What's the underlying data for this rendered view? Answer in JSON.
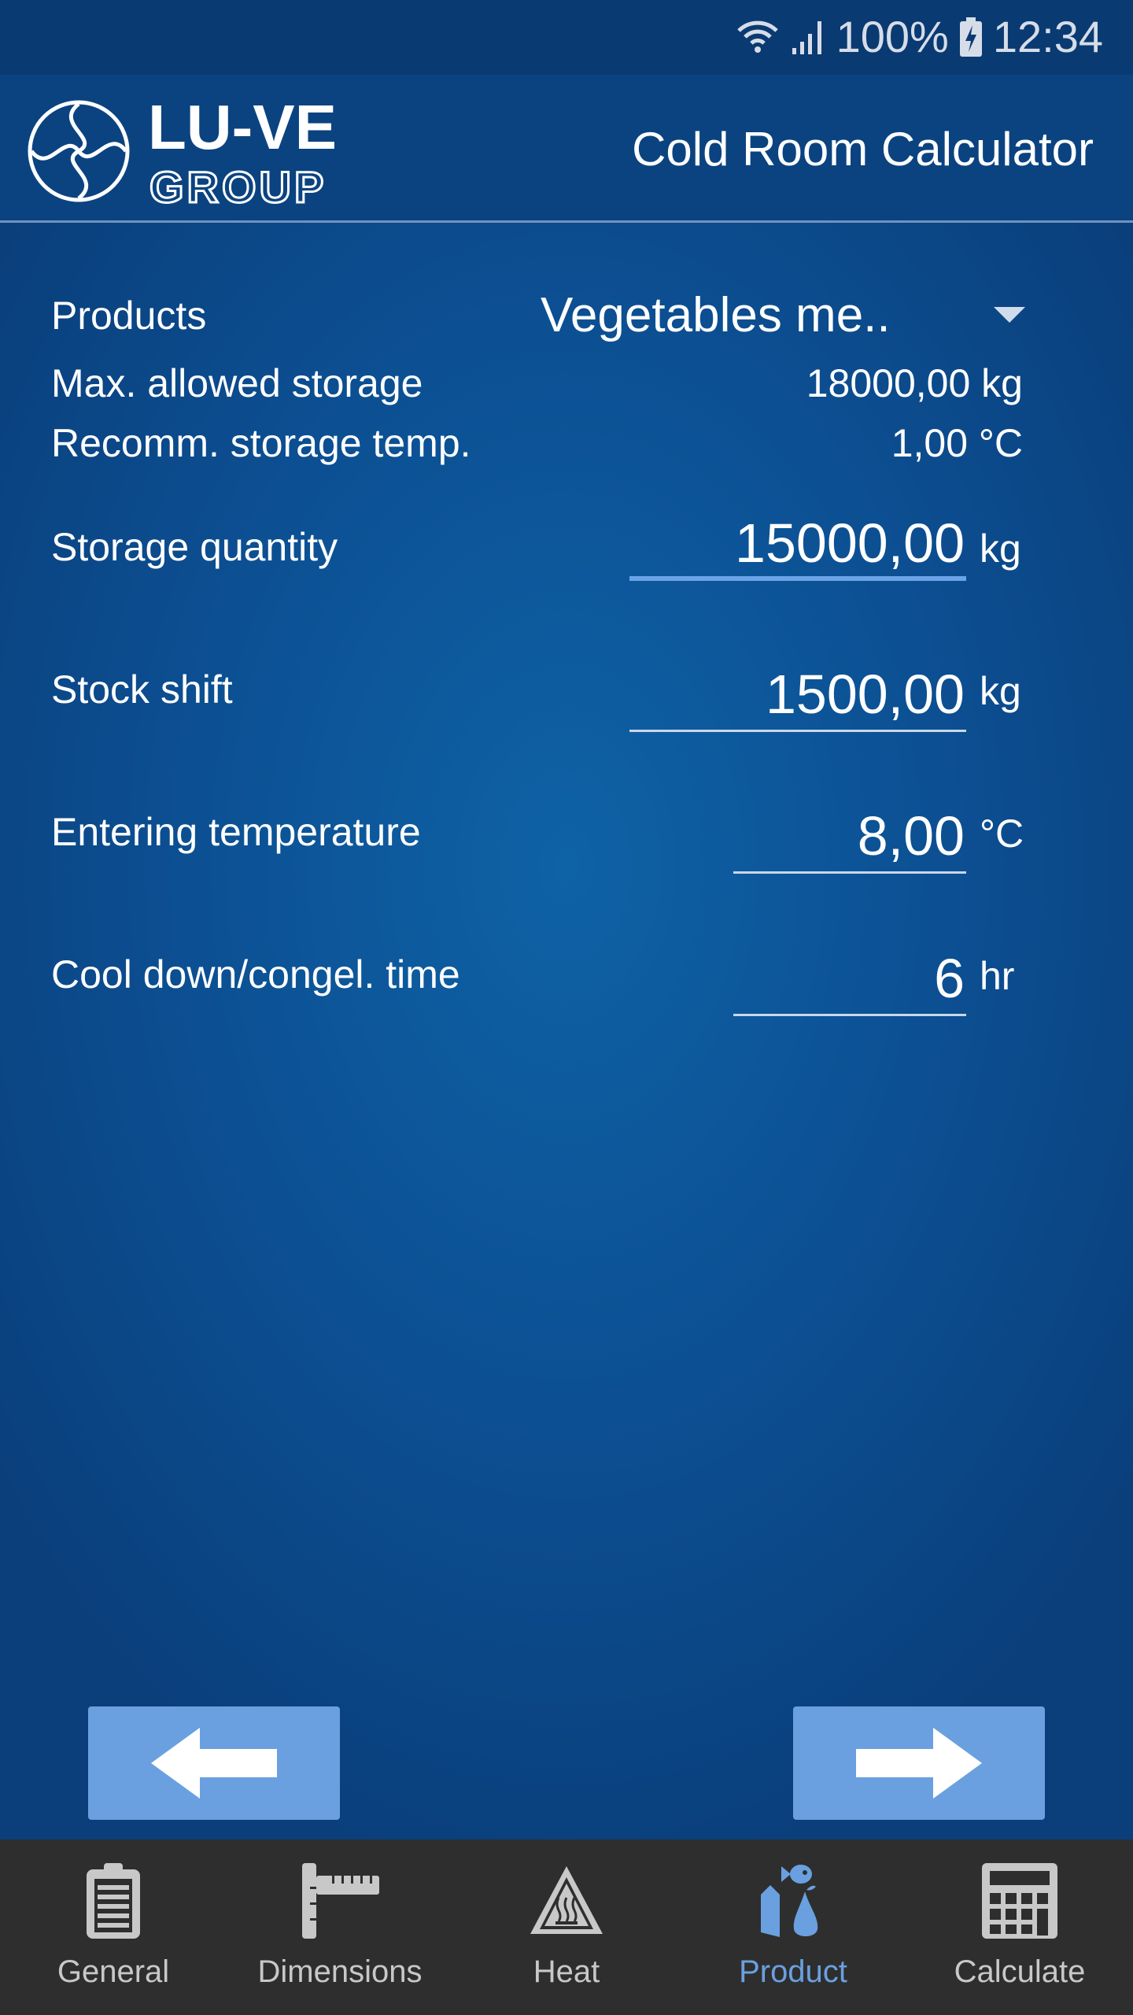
{
  "status_bar": {
    "battery": "100%",
    "time": "12:34"
  },
  "header": {
    "logo_text": "LU-VE GROUP",
    "title": "Cold Room Calculator"
  },
  "form": {
    "products": {
      "label": "Products",
      "value": "Vegetables me.."
    },
    "max_storage": {
      "label": "Max. allowed storage",
      "value": "18000,00 kg"
    },
    "recomm_temp": {
      "label": "Recomm. storage temp.",
      "value": "1,00 °C"
    },
    "storage_quantity": {
      "label": "Storage quantity",
      "value": "15000,00",
      "unit": "kg"
    },
    "stock_shift": {
      "label": "Stock shift",
      "value": "1500,00",
      "unit": "kg"
    },
    "entering_temp": {
      "label": "Entering temperature",
      "value": "8,00",
      "unit": "°C"
    },
    "cool_down": {
      "label": "Cool down/congel. time",
      "value": "6",
      "unit": "hr"
    }
  },
  "nav": {
    "active": "Product",
    "accent": "#6aa0e0",
    "items": [
      {
        "label": "General"
      },
      {
        "label": "Dimensions"
      },
      {
        "label": "Heat"
      },
      {
        "label": "Product"
      },
      {
        "label": "Calculate"
      }
    ]
  }
}
